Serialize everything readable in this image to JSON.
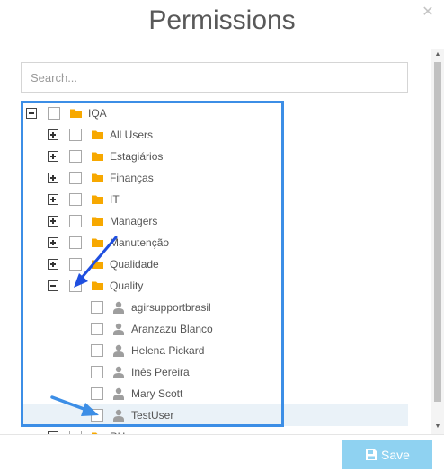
{
  "modal": {
    "title": "Permissions",
    "close_icon": "close-icon"
  },
  "search": {
    "placeholder": "Search...",
    "value": ""
  },
  "tree": {
    "root": {
      "label": "IQA",
      "expanded": true,
      "icon": "folder-icon"
    },
    "groups": [
      {
        "label": "All Users",
        "expanded": false
      },
      {
        "label": "Estagiários",
        "expanded": false
      },
      {
        "label": "Finanças",
        "expanded": false
      },
      {
        "label": "IT",
        "expanded": false
      },
      {
        "label": "Managers",
        "expanded": false
      },
      {
        "label": "Manutenção",
        "expanded": false
      },
      {
        "label": "Qualidade",
        "expanded": false
      },
      {
        "label": "Quality",
        "expanded": true
      }
    ],
    "quality_users": [
      {
        "label": "agirsupportbrasil"
      },
      {
        "label": "Aranzazu Blanco"
      },
      {
        "label": "Helena Pickard"
      },
      {
        "label": "Inês Pereira"
      },
      {
        "label": "Mary Scott"
      },
      {
        "label": "TestUser",
        "selected": true
      }
    ],
    "partial_next_group": {
      "label": "RH"
    }
  },
  "footer": {
    "save_label": "Save",
    "save_icon": "floppy-disk-icon"
  },
  "colors": {
    "folder": "#f7a800",
    "user_icon": "#9e9e9e",
    "focus_outline": "#3c8ee6",
    "annotation_arrow": "#1f4fe0",
    "save_button": "#8fd2f1",
    "selected_row": "#eaf2f8"
  }
}
